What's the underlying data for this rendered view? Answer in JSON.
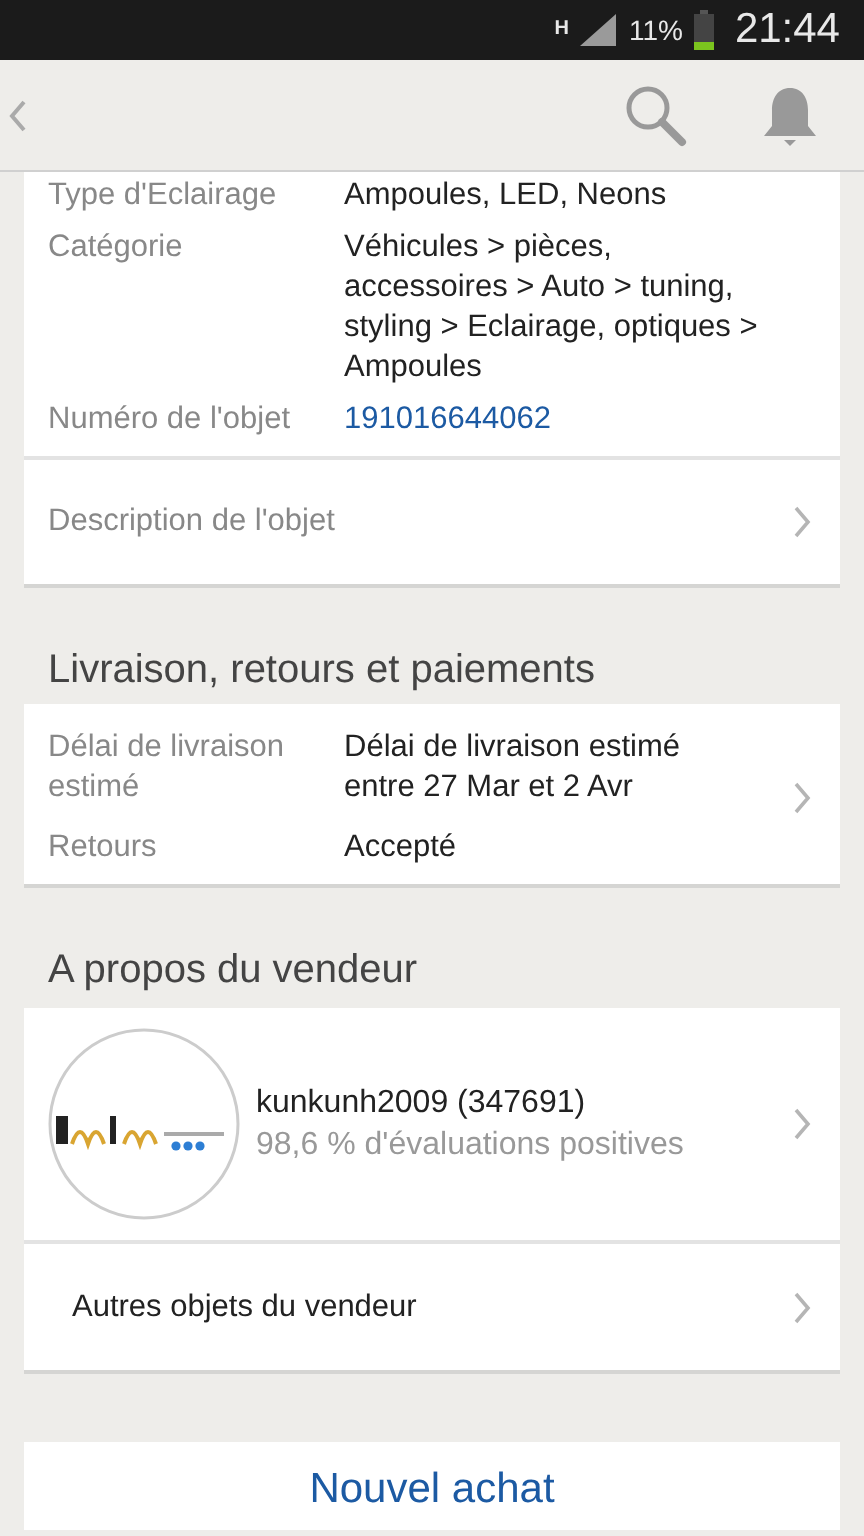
{
  "status_bar": {
    "network": "H",
    "battery_percent": "11%",
    "time": "21:44"
  },
  "item_details": [
    {
      "label": "Type d'Eclairage",
      "value": "Ampoules, LED, Neons",
      "kind": "text"
    },
    {
      "label": "Catégorie",
      "value": "Véhicules >  pièces, accessoires > Auto >  tuning, styling > Eclairage, optiques > Ampoules",
      "kind": "text"
    },
    {
      "label": "Numéro de l'objet",
      "value": "191016644062",
      "kind": "link"
    }
  ],
  "description_row": {
    "label": "Description de l'objet"
  },
  "shipping": {
    "title": "Livraison, retours et paiements",
    "rows": [
      {
        "label": "Délai de livraison estimé",
        "value": "Délai de livraison estimé entre 27 Mar et 2 Avr"
      },
      {
        "label": "Retours",
        "value": "Accepté"
      }
    ]
  },
  "seller": {
    "title": "A propos du vendeur",
    "name": "kunkunh2009 (347691)",
    "feedback": "98,6 % d'évaluations positives",
    "other_items": "Autres objets du vendeur"
  },
  "primary_button": {
    "label": "Nouvel achat"
  }
}
